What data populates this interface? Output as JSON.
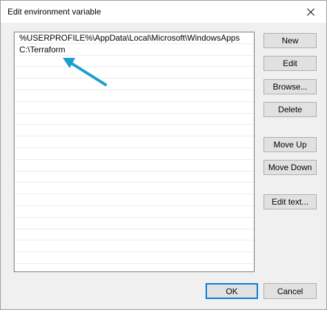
{
  "window": {
    "title": "Edit environment variable"
  },
  "list": {
    "entries": [
      "%USERPROFILE%\\AppData\\Local\\Microsoft\\WindowsApps",
      "C:\\Terraform"
    ]
  },
  "buttons": {
    "new": "New",
    "edit": "Edit",
    "browse": "Browse...",
    "delete": "Delete",
    "move_up": "Move Up",
    "move_down": "Move Down",
    "edit_text": "Edit text...",
    "ok": "OK",
    "cancel": "Cancel"
  },
  "icons": {
    "close": "close-icon",
    "annotation": "annotation-arrow-icon"
  },
  "colors": {
    "arrow": "#1a9fd0",
    "accent": "#0078d7"
  }
}
